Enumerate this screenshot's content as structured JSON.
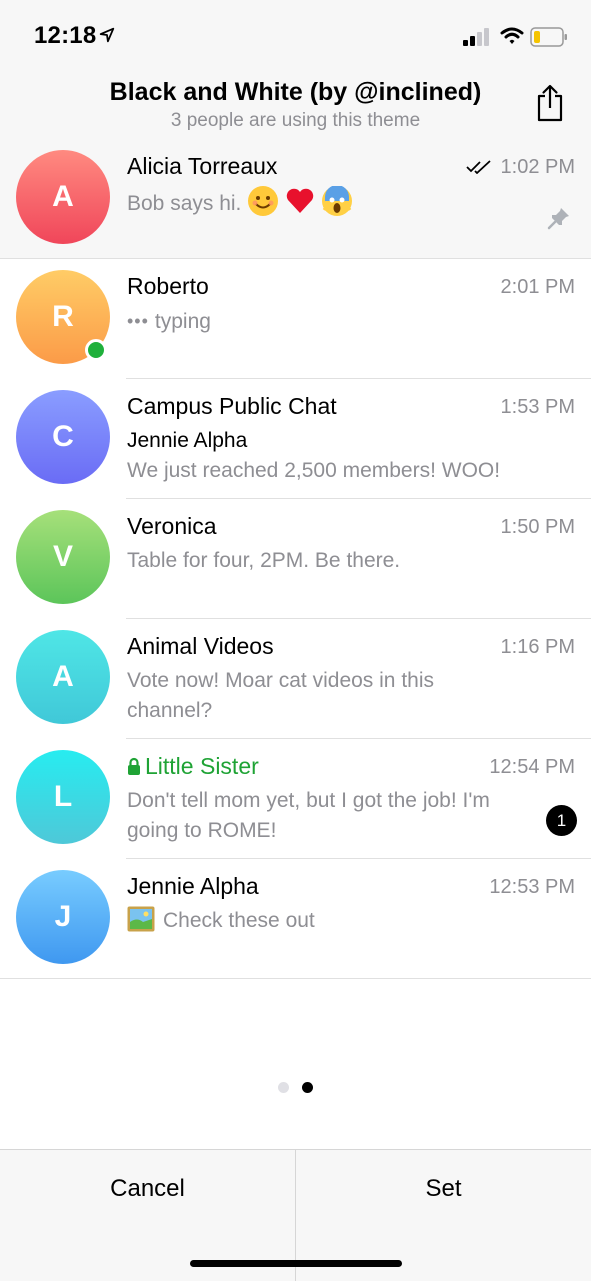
{
  "status": {
    "time": "12:18"
  },
  "header": {
    "title": "Black and White (by @inclined)",
    "subtitle": "3 people are using this theme"
  },
  "chats": [
    {
      "initial": "A",
      "name": "Alicia Torreaux",
      "time": "1:02 PM",
      "message": "Bob says hi.",
      "pinned": true,
      "read": true,
      "gradient": [
        "#ff8a80",
        "#f0465a"
      ]
    },
    {
      "initial": "R",
      "name": "Roberto",
      "time": "2:01 PM",
      "message": "typing",
      "online": true,
      "gradient": [
        "#ffcc66",
        "#fb9b48"
      ]
    },
    {
      "initial": "C",
      "name": "Campus Public Chat",
      "time": "1:53 PM",
      "author": "Jennie Alpha",
      "message": "We just reached 2,500 members! WOO!",
      "gradient": [
        "#8a9dff",
        "#6a6cf5"
      ]
    },
    {
      "initial": "V",
      "name": "Veronica",
      "time": "1:50 PM",
      "message": "Table for four, 2PM. Be there.",
      "gradient": [
        "#a6e07a",
        "#5cc55a"
      ]
    },
    {
      "initial": "A",
      "name": "Animal Videos",
      "time": "1:16 PM",
      "message": "Vote now! Moar cat videos in this channel?",
      "gradient": [
        "#4fe6e6",
        "#40c8d8"
      ]
    },
    {
      "initial": "L",
      "name": "Little Sister",
      "time": "12:54 PM",
      "message": "Don't tell mom yet, but I got the job! I'm going to ROME!",
      "secret": true,
      "unread": "1",
      "gradient": [
        "#27ecf0",
        "#4ec8d8"
      ]
    },
    {
      "initial": "J",
      "name": "Jennie Alpha",
      "time": "12:53 PM",
      "message": "Check these out",
      "gradient": [
        "#78ccff",
        "#3f98f0"
      ]
    }
  ],
  "pager": {
    "count": 2,
    "active": 1
  },
  "footer": {
    "cancel": "Cancel",
    "set": "Set"
  },
  "colors": {
    "secret_name": "#1fa335",
    "secondary": "#8e8e93",
    "online": "#1fb03b"
  }
}
